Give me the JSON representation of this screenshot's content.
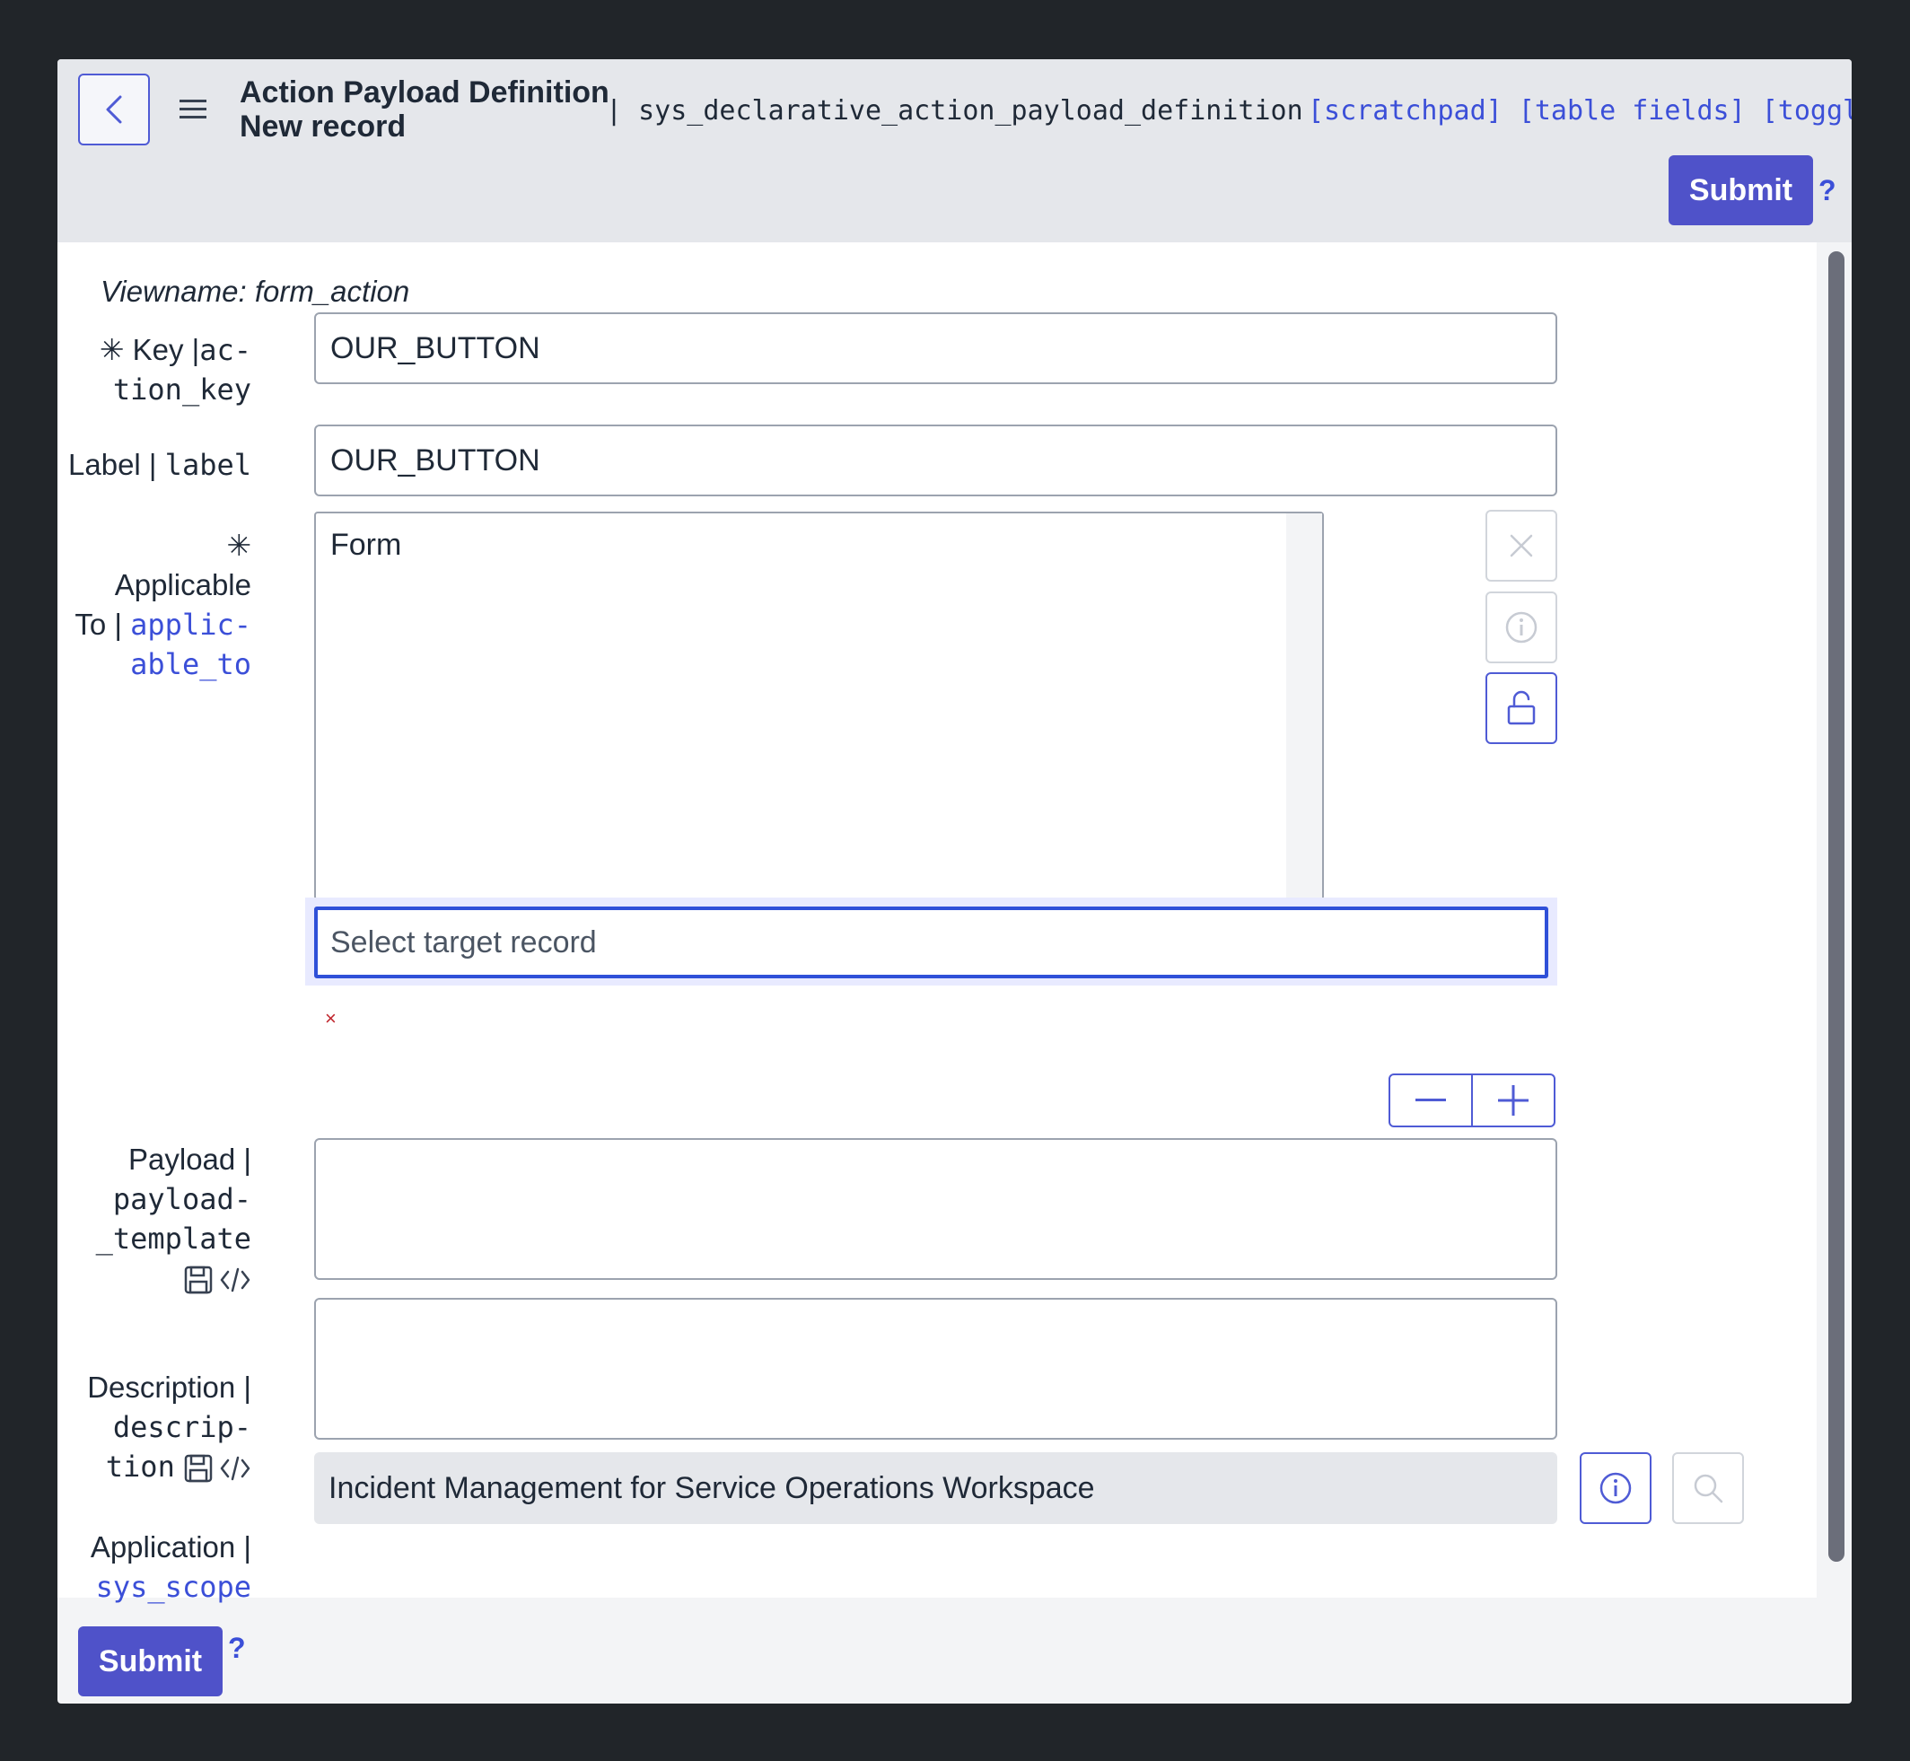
{
  "header": {
    "title_line1": "Action Payload Definition",
    "title_line2": "New record",
    "table_name": "| sys_declarative_action_payload_definition",
    "links": "[scratchpad] [table fields] [toggle",
    "submit_label": "Submit",
    "help": "?"
  },
  "form": {
    "viewname": "Viewname: form_action",
    "key": {
      "required": "✳",
      "label": "Key |",
      "field_line1": "ac-",
      "field_line2": "tion_key",
      "value": "OUR_BUTTON"
    },
    "label_field": {
      "label": "Label |",
      "field": "label",
      "value": "OUR_BUTTON"
    },
    "applicable_to": {
      "required": "✳",
      "label_line1": "Applicable",
      "label_line2": "To |",
      "field_line1": "applic-",
      "field_line2": "able_to",
      "items": [
        "Form"
      ],
      "target_placeholder": "Select target record",
      "x_mark": "×"
    },
    "payload": {
      "label": "Payload |",
      "field_line1": "payload-",
      "field_line2": "_template",
      "value": ""
    },
    "description": {
      "label": "Description |",
      "field_line1": "descrip-",
      "field_line2": "tion",
      "value": ""
    },
    "application": {
      "label": "Application |",
      "field": "sys_scope",
      "value": "Incident Management for Service Operations Workspace"
    }
  },
  "footer": {
    "submit_label": "Submit",
    "help": "?"
  },
  "colors": {
    "accent": "#4f52c9",
    "link": "#3b4fd8",
    "annotation_arrow": "#b0252e"
  },
  "icons": [
    "chevron-left-icon",
    "hamburger-menu-icon",
    "close-icon",
    "info-icon",
    "unlock-icon",
    "minus-icon",
    "plus-icon",
    "save-icon",
    "code-icon",
    "search-icon",
    "arrow-annotation-icon"
  ]
}
